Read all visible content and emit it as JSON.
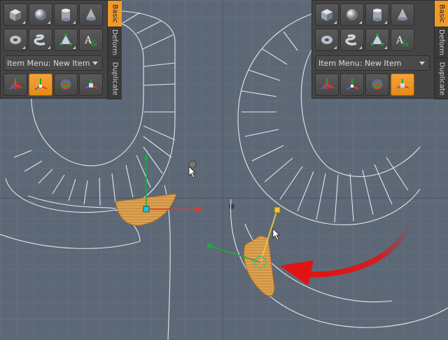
{
  "colors": {
    "viewport_bg": "#5d6877",
    "grid_line": "#6a7584",
    "wire_edge": "#dfe3ea",
    "active_orange": "#f09a2a",
    "selection_fill": "#e0a255",
    "red_arrow": "#e41313",
    "axis_green": "#1fa83c",
    "axis_red": "#e33a2a",
    "axis_yellow": "#f1c53a"
  },
  "left_panel": {
    "icons_row1": [
      "cube-icon",
      "sphere-icon",
      "cylinder-icon",
      "cone-icon"
    ],
    "icons_row2": [
      "torus-icon",
      "capsule-icon",
      "pen-tool-icon",
      "text-item-icon"
    ],
    "item_menu_label": "Item Menu: New Item",
    "icons_row4": [
      "move-tool-icon",
      "rotate-tool-icon",
      "transform-tool-icon",
      "scale-tool-icon"
    ],
    "active_tool_index": 1,
    "tabs": [
      "Basic",
      "Deform",
      "Duplicate"
    ],
    "active_tab": "Basic"
  },
  "right_panel": {
    "icons_row1": [
      "cube-icon",
      "sphere-icon",
      "cylinder-icon",
      "cone-icon"
    ],
    "icons_row2": [
      "torus-icon",
      "capsule-icon",
      "pen-tool-icon",
      "text-item-icon"
    ],
    "item_menu_label": "Item Menu: New Item",
    "icons_row4": [
      "move-tool-icon",
      "rotate-tool-icon",
      "transform-tool-icon",
      "scale-tool-icon"
    ],
    "active_tool_index": 3,
    "tabs": [
      "Basic",
      "Deform",
      "Duplicate"
    ],
    "active_tab": "Basic"
  }
}
